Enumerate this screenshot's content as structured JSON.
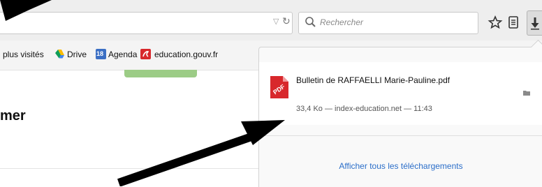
{
  "search": {
    "placeholder": "Rechercher"
  },
  "bookmarks": [
    {
      "label": "plus visités",
      "icon": "most-visited"
    },
    {
      "label": "Drive",
      "icon": "google-drive-icon"
    },
    {
      "label": "Agenda",
      "icon": "calendar-icon",
      "badge": "18"
    },
    {
      "label": "education.gouv.fr",
      "icon": "education-icon"
    }
  ],
  "page": {
    "heading_fragment": "mer"
  },
  "downloads": {
    "item": {
      "filename": "Bulletin de RAFFAELLI Marie-Pauline.pdf",
      "meta": "33,4 Ko — index-education.net — 11:43",
      "icon": "pdf-icon"
    },
    "show_all_label": "Afficher tous les téléchargements"
  },
  "colors": {
    "link": "#2b6ec9",
    "pdf_red": "#d8282c",
    "drive_blue": "#4285f4",
    "agenda_blue": "#3b6fc4"
  }
}
